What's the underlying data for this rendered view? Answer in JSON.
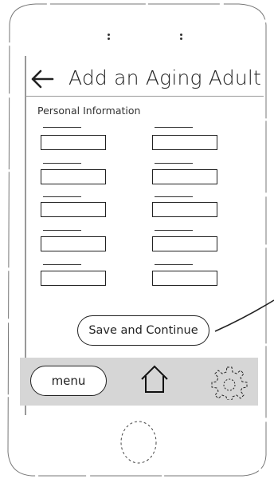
{
  "screen": {
    "title": "Add an Aging Adult",
    "section_label": "Personal Information"
  },
  "form": {
    "fields": [
      {
        "label": "",
        "value": ""
      },
      {
        "label": "",
        "value": ""
      },
      {
        "label": "",
        "value": ""
      },
      {
        "label": "",
        "value": ""
      },
      {
        "label": "",
        "value": ""
      },
      {
        "label": "",
        "value": ""
      },
      {
        "label": "",
        "value": ""
      },
      {
        "label": "",
        "value": ""
      },
      {
        "label": "",
        "value": ""
      },
      {
        "label": "",
        "value": ""
      }
    ],
    "save_label": "Save and Continue"
  },
  "nav": {
    "menu_label": "menu",
    "home_icon": "home-icon",
    "settings_icon": "gear-icon"
  },
  "colors": {
    "nav_background": "#d6d6d6",
    "stroke": "#222222"
  }
}
